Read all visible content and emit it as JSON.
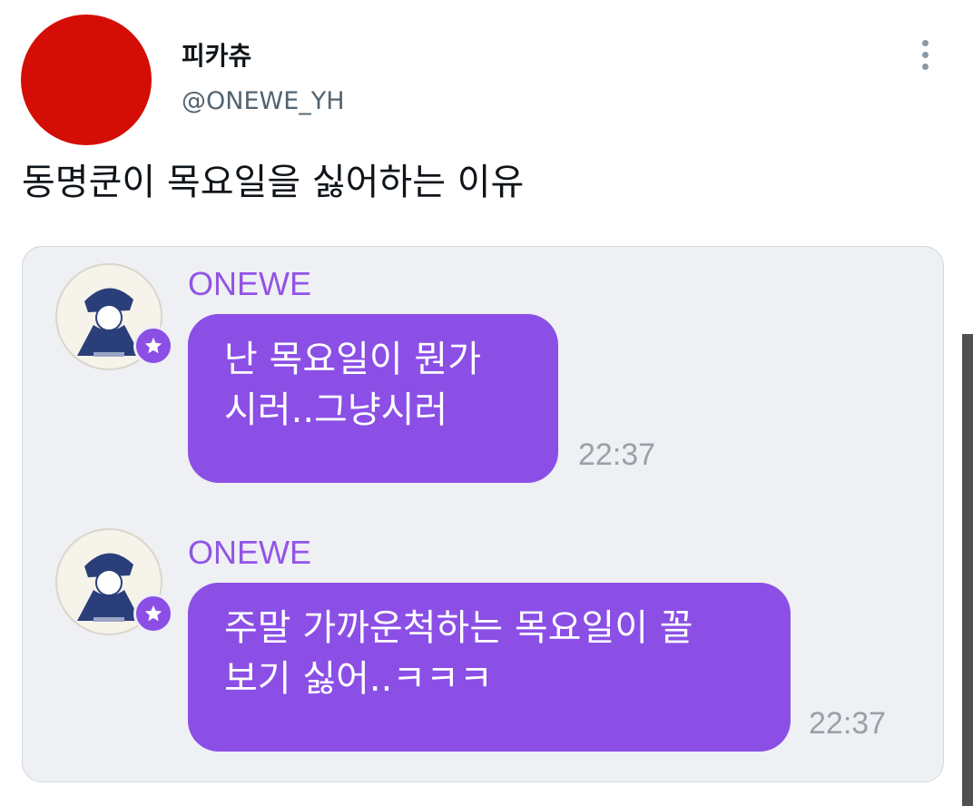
{
  "user": {
    "display_name": "피카츄",
    "handle": "@ONEWE_YH",
    "avatar_color": "#d40d06"
  },
  "tweet": {
    "text": "동명쿤이 목요일을 싫어하는 이유"
  },
  "chat": {
    "accent_color": "#8b4fe6",
    "messages": [
      {
        "sender": "ONEWE",
        "lines": [
          "난 목요일이 뭔가",
          "시러..그냥시러"
        ],
        "time": "22:37"
      },
      {
        "sender": "ONEWE",
        "lines": [
          "주말 가까운척하는 목요일이 꼴",
          "보기 싫어..ㅋㅋㅋ"
        ],
        "time": "22:37"
      }
    ]
  },
  "icons": {
    "more": "more-vertical-icon",
    "badge": "star-icon"
  }
}
